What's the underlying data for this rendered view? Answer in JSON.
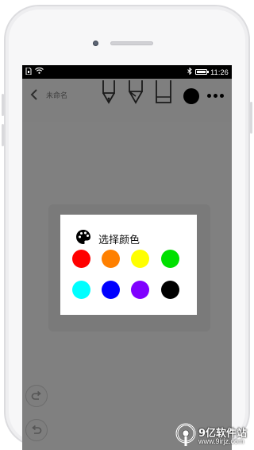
{
  "status_bar": {
    "time": "11:26",
    "battery_percent": 100,
    "left_icons": [
      "sim-icon",
      "wifi-icon"
    ],
    "right_icons": [
      "bluetooth-icon",
      "battery-icon"
    ]
  },
  "toolbar": {
    "title": "未命名",
    "tools": [
      "fountain-pen-icon",
      "marker-icon",
      "highlighter-icon"
    ],
    "current_color": "#000000"
  },
  "dialog": {
    "title": "选择颜色",
    "colors": [
      {
        "name": "red",
        "hex": "#ff0000"
      },
      {
        "name": "orange",
        "hex": "#ff8000"
      },
      {
        "name": "yellow",
        "hex": "#ffff00"
      },
      {
        "name": "green",
        "hex": "#00e000"
      },
      {
        "name": "cyan",
        "hex": "#00ffff"
      },
      {
        "name": "blue",
        "hex": "#0000ff"
      },
      {
        "name": "purple",
        "hex": "#8000ff"
      },
      {
        "name": "black",
        "hex": "#000000"
      }
    ]
  },
  "floating_buttons": [
    "redo-icon",
    "undo-icon"
  ],
  "watermark": {
    "brand": "9亿软件站",
    "url": "www.9irjz.com"
  }
}
